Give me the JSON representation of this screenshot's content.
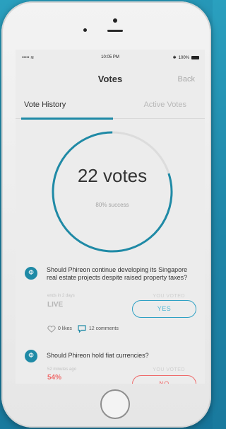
{
  "status_bar": {
    "signal": "••••• ",
    "time": "10:05 PM",
    "battery": "100%"
  },
  "nav": {
    "title": "Votes",
    "back_label": "Back"
  },
  "tabs": [
    {
      "label": "Vote History",
      "selected": true
    },
    {
      "label": "Active Votes",
      "selected": false
    }
  ],
  "summary": {
    "votes_label": "22 votes",
    "success_label": "80% success",
    "success_fraction": 0.8
  },
  "votes": [
    {
      "question": "Should Phireon continue developing its Singapore real estate projects despite raised property taxes?",
      "time": "ends in 2 days",
      "status": "LIVE",
      "you_voted_label": "YOU VOTED",
      "vote": "YES",
      "likes": "0 likes",
      "comments": "12 comments"
    },
    {
      "question": "Should Phireon hold fiat currencies?",
      "time": "52 minutes ago",
      "status": "54%",
      "you_voted_label": "YOU VOTED",
      "vote": "NO"
    }
  ],
  "colors": {
    "accent": "#1f8aa6",
    "yes": "#2fa1c4",
    "no": "#ef6a6a",
    "status_live": "#b5b5b5",
    "status_percent": "#ef6a6a"
  }
}
